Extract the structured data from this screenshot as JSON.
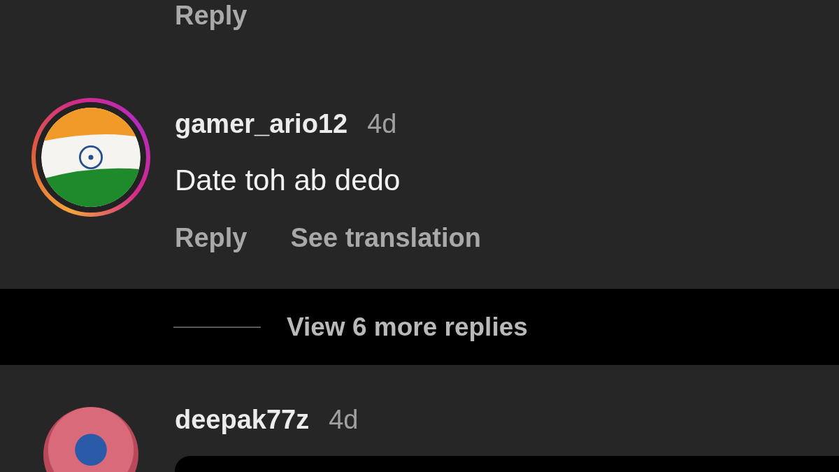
{
  "previous_comment": {
    "reply_label": "Reply"
  },
  "comments": [
    {
      "username": "gamer_ario12",
      "time": "4d",
      "story_ring": true,
      "kind": "flag",
      "text": "Date toh ab dedo",
      "actions": [
        "Reply",
        "See translation"
      ],
      "view_replies": "View 6 more replies"
    },
    {
      "username": "deepak77z",
      "time": "4d",
      "story_ring": false,
      "kind": "photo",
      "media": true
    }
  ]
}
